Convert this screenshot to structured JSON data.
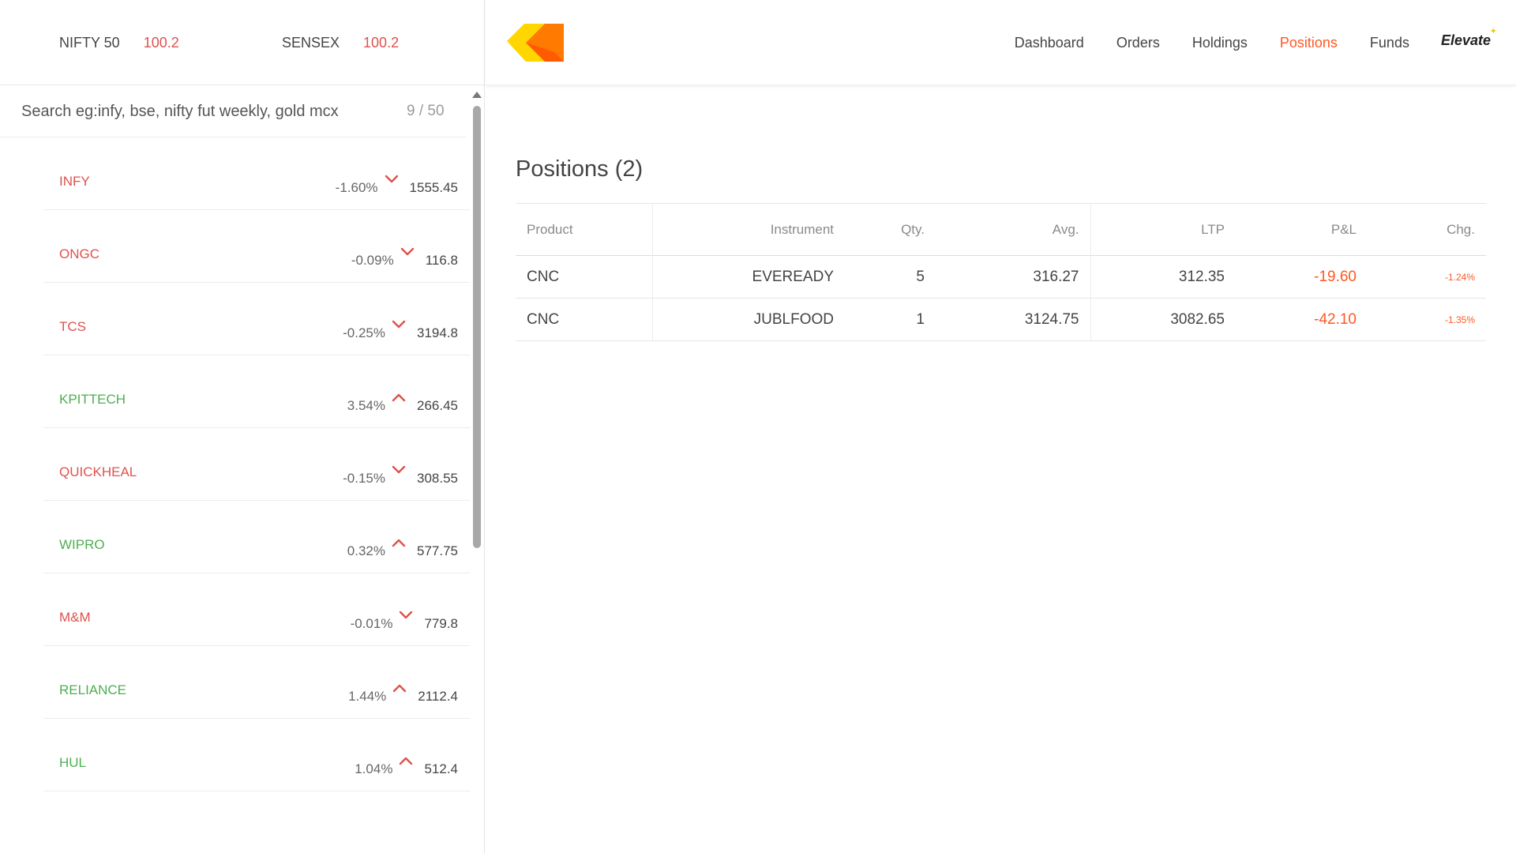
{
  "indices": [
    {
      "name": "NIFTY 50",
      "value": "100.2"
    },
    {
      "name": "SENSEX",
      "value": "100.2"
    }
  ],
  "search": {
    "placeholder": "Search eg:infy, bse, nifty fut weekly, gold mcx",
    "count": "9 / 50"
  },
  "watchlist": [
    {
      "symbol": "INFY",
      "change": "-1.60%",
      "price": "1555.45",
      "direction": "down"
    },
    {
      "symbol": "ONGC",
      "change": "-0.09%",
      "price": "116.8",
      "direction": "down"
    },
    {
      "symbol": "TCS",
      "change": "-0.25%",
      "price": "3194.8",
      "direction": "down"
    },
    {
      "symbol": "KPITTECH",
      "change": "3.54%",
      "price": "266.45",
      "direction": "up"
    },
    {
      "symbol": "QUICKHEAL",
      "change": "-0.15%",
      "price": "308.55",
      "direction": "down"
    },
    {
      "symbol": "WIPRO",
      "change": "0.32%",
      "price": "577.75",
      "direction": "up"
    },
    {
      "symbol": "M&M",
      "change": "-0.01%",
      "price": "779.8",
      "direction": "down"
    },
    {
      "symbol": "RELIANCE",
      "change": "1.44%",
      "price": "2112.4",
      "direction": "up"
    },
    {
      "symbol": "HUL",
      "change": "1.04%",
      "price": "512.4",
      "direction": "up"
    }
  ],
  "nav": {
    "items": [
      "Dashboard",
      "Orders",
      "Holdings",
      "Positions",
      "Funds"
    ],
    "active": "Positions",
    "brand": "Elevate"
  },
  "positions": {
    "title": "Positions (2)",
    "columns": [
      "Product",
      "Instrument",
      "Qty.",
      "Avg.",
      "LTP",
      "P&L",
      "Chg."
    ],
    "rows": [
      {
        "product": "CNC",
        "instrument": "EVEREADY",
        "qty": "5",
        "avg": "316.27",
        "ltp": "312.35",
        "pnl": "-19.60",
        "chg": "-1.24%"
      },
      {
        "product": "CNC",
        "instrument": "JUBLFOOD",
        "qty": "1",
        "avg": "3124.75",
        "ltp": "3082.65",
        "pnl": "-42.10",
        "chg": "-1.35%"
      }
    ]
  },
  "colors": {
    "negative": "#df514c",
    "positive": "#4caf50",
    "accent": "#ff5722",
    "logo_yellow": "#ffd600",
    "logo_orange": "#ff7a00"
  }
}
